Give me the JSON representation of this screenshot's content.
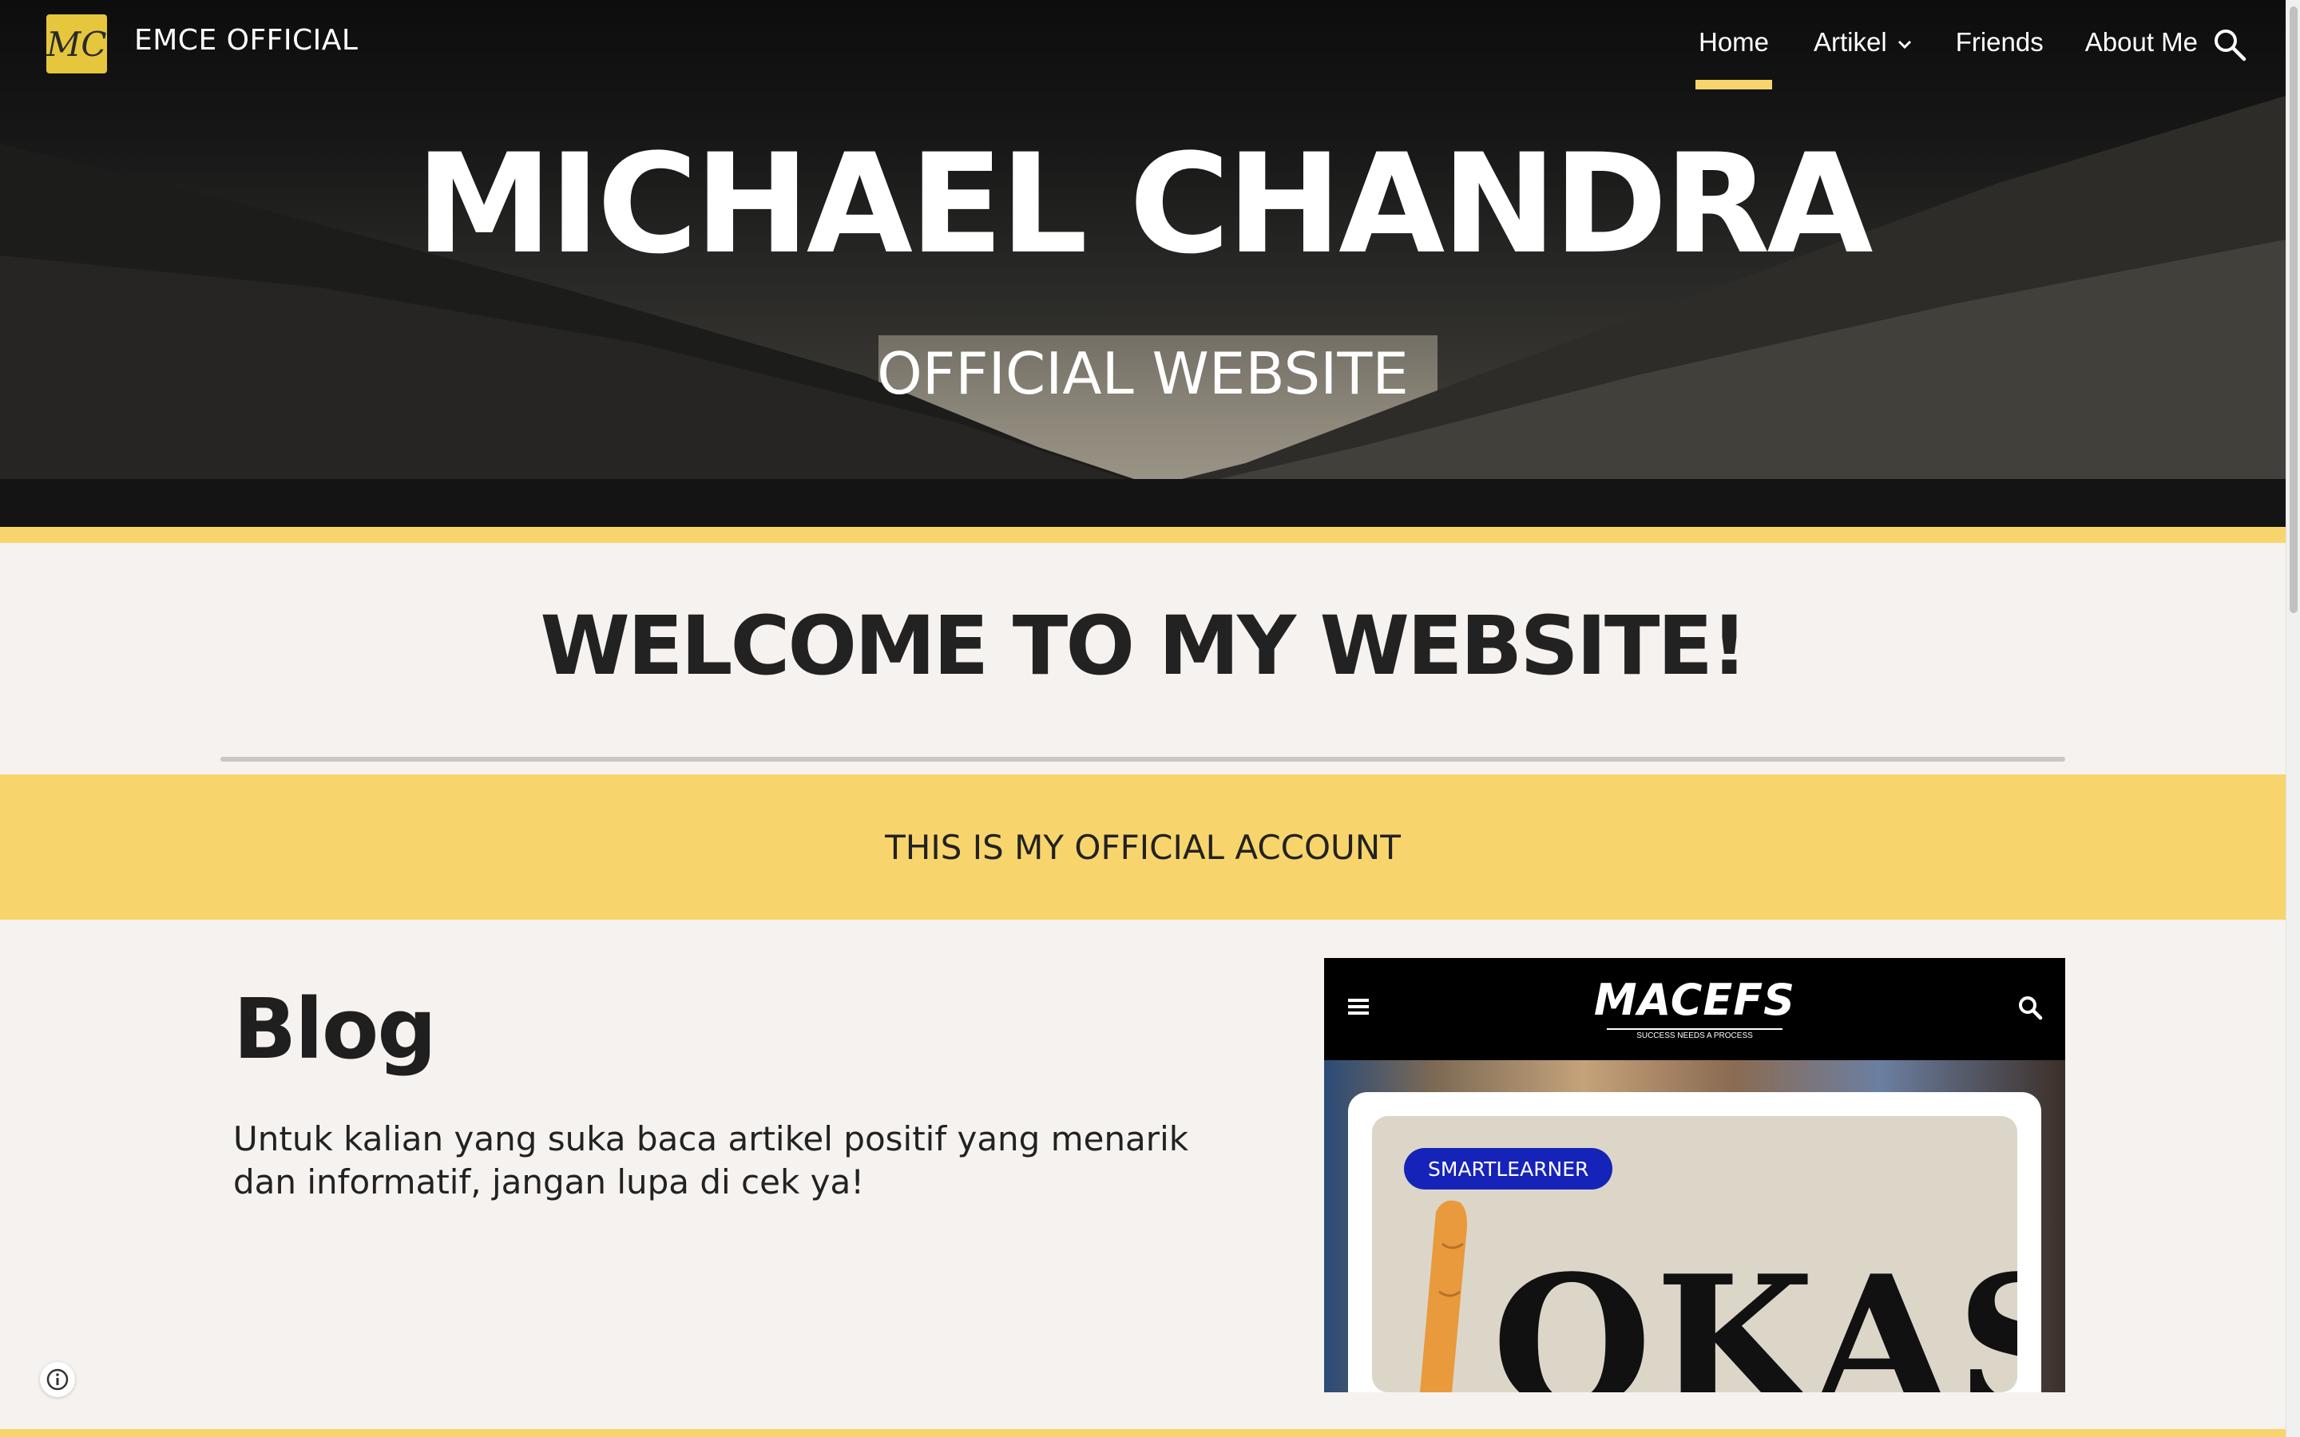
{
  "header": {
    "logo_text": "MC",
    "site_title": "EMCE OFFICIAL",
    "nav": [
      {
        "label": "Home",
        "active": true
      },
      {
        "label": "Artikel",
        "has_dropdown": true
      },
      {
        "label": "Friends"
      },
      {
        "label": "About Me"
      }
    ],
    "search_icon": "search-icon"
  },
  "hero": {
    "title": "MICHAEL CHANDRA",
    "subtitle": "OFFICIAL WEBSITE"
  },
  "welcome": {
    "heading": "WELCOME TO MY WEBSITE!"
  },
  "band": {
    "text": "THIS IS MY OFFICIAL ACCOUNT"
  },
  "blog": {
    "heading": "Blog",
    "text": "Untuk kalian yang suka baca artikel positif yang menarik dan informatif, jangan lupa di cek ya!"
  },
  "embed": {
    "logo": "MACEFS",
    "tagline": "SUCCESS NEEDS A PROCESS",
    "tag": "SMARTLEARNER",
    "image_text": "OKAS"
  },
  "colors": {
    "accent": "#f8d56c",
    "tag_blue": "#1623b8",
    "page_bg": "#f5f2ef",
    "text_dark": "#222222"
  }
}
